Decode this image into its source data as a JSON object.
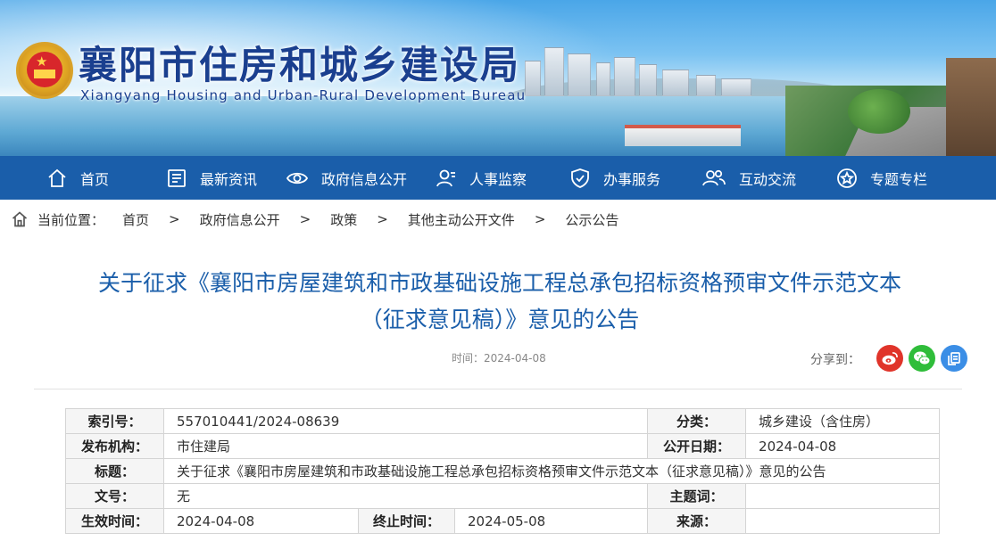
{
  "header": {
    "title": "襄阳市住房和城乡建设局",
    "subtitle": "Xiangyang Housing and Urban-Rural Development Bureau"
  },
  "nav": {
    "items": [
      {
        "label": "首页",
        "icon": "home-icon"
      },
      {
        "label": "最新资讯",
        "icon": "news-icon"
      },
      {
        "label": "政府信息公开",
        "icon": "eye-icon"
      },
      {
        "label": "人事监察",
        "icon": "person-icon"
      },
      {
        "label": "办事服务",
        "icon": "shield-icon"
      },
      {
        "label": "互动交流",
        "icon": "people-icon"
      },
      {
        "label": "专题专栏",
        "icon": "star-icon"
      }
    ]
  },
  "breadcrumb": {
    "prefix": "当前位置：",
    "separator": ">",
    "items": [
      "首页",
      "政府信息公开",
      "政策",
      "其他主动公开文件",
      "公示公告"
    ]
  },
  "article": {
    "title_line1": "关于征求《襄阳市房屋建筑和市政基础设施工程总承包招标资格预审文件示范文本",
    "title_line2": "（征求意见稿）》意见的公告",
    "time": "时间：2024-04-08",
    "share_label": "分享到：",
    "share": [
      {
        "icon": "weibo-icon",
        "color": "#e0342a"
      },
      {
        "icon": "wechat-icon",
        "color": "#2fbd3a"
      },
      {
        "icon": "copy-icon",
        "color": "#3b8ee6"
      }
    ]
  },
  "meta": {
    "index_label": "索引号：",
    "index_value": "557010441/2024-08639",
    "category_label": "分类：",
    "category_value": "城乡建设（含住房）",
    "publisher_label": "发布机构：",
    "publisher_value": "市住建局",
    "date_label": "公开日期：",
    "date_value": "2024-04-08",
    "title_label": "标题：",
    "title_value": "关于征求《襄阳市房屋建筑和市政基础设施工程总承包招标资格预审文件示范文本（征求意见稿）》意见的公告",
    "docno_label": "文号：",
    "docno_value": "无",
    "subject_label": "主题词：",
    "subject_value": "",
    "effective_label": "生效时间：",
    "effective_value": "2024-04-08",
    "end_label": "终止时间：",
    "end_value": "2024-05-08",
    "source_label": "来源：",
    "source_value": ""
  }
}
